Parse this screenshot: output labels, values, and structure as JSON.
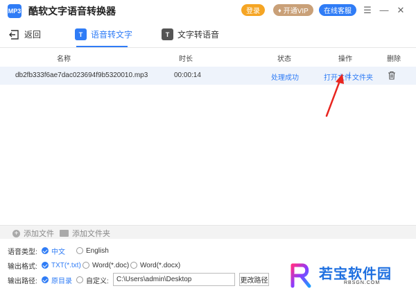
{
  "app": {
    "logo_text": "MP3",
    "title": "酷软文字语音转换器",
    "login_label": "登录",
    "vip_label": "开通VIP",
    "service_label": "在线客服"
  },
  "nav": {
    "back_label": "返回",
    "tab_speech_to_text": "语音转文字",
    "tab_text_to_speech": "文字转语音"
  },
  "table": {
    "headers": {
      "name": "名称",
      "duration": "时长",
      "status": "状态",
      "action": "操作",
      "delete": "删除"
    },
    "rows": [
      {
        "name": "db2fb333f6ae7dac023694f9b5320010.mp3",
        "duration": "00:00:14",
        "status": "处理成功",
        "open_file": "打开文件",
        "sep": "|",
        "open_folder": "文件夹"
      }
    ]
  },
  "addbar": {
    "add_file": "添加文件",
    "add_folder": "添加文件夹"
  },
  "options": {
    "voice_type_label": "语音类型:",
    "voice_cn": "中文",
    "voice_en": "English",
    "format_label": "输出格式:",
    "fmt_txt": "TXT(*.txt)",
    "fmt_doc": "Word(*.doc)",
    "fmt_docx": "Word(*.docx)",
    "path_label": "输出路径:",
    "path_original": "原目录",
    "path_custom": "自定义:",
    "path_value": "C:\\Users\\admin\\Desktop",
    "change_path": "更改路径"
  },
  "watermark": {
    "name": "若宝软件园",
    "url": "RBSGN.COM"
  },
  "colors": {
    "accent": "#2f7cf6",
    "login": "#f5a524",
    "vip": "#c9a078",
    "arrow": "#e8251f"
  }
}
